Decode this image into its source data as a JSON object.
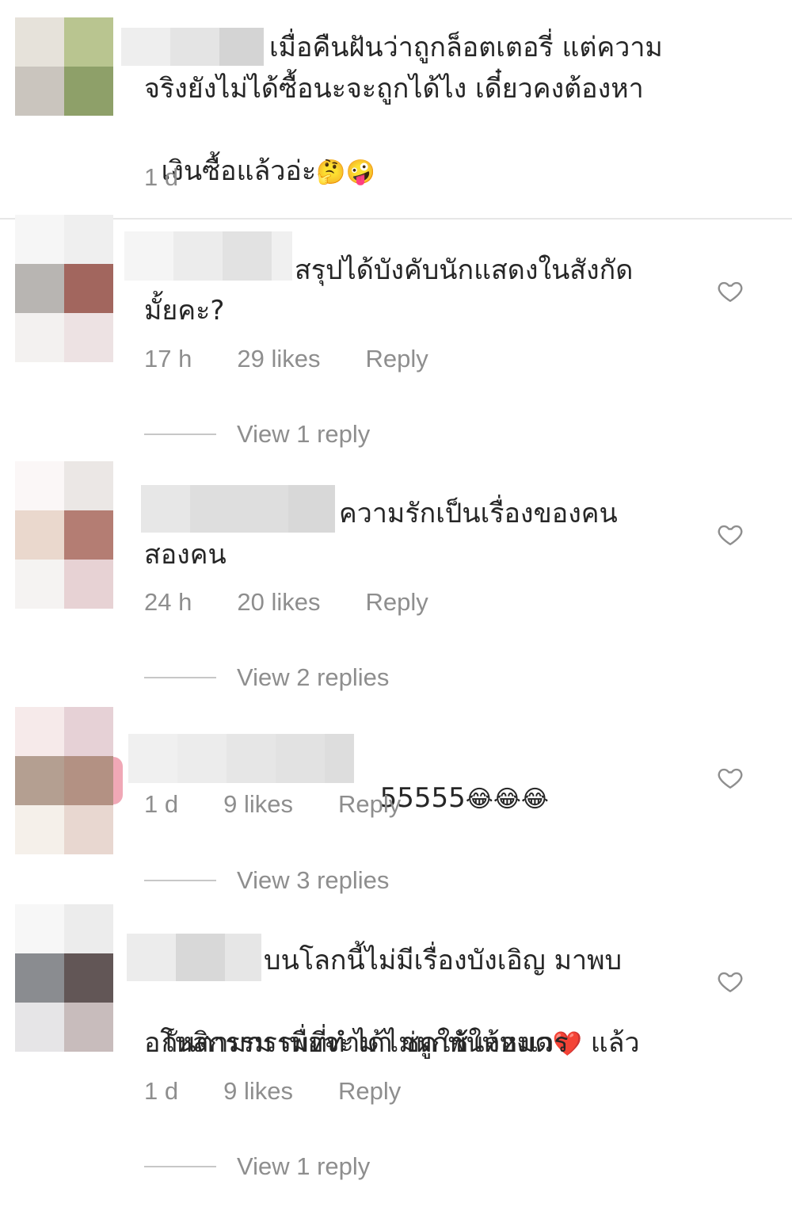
{
  "comments": [
    {
      "text_lines": [
        "เมื่อคืนฝันว่าถูกล็อตเตอรี่ แต่ความ",
        "จริงยังไม่ได้ซื้อนะจะถูกได้ไง เดี๋ยวคงต้องหา",
        "เงินซื้อแล้วอ่ะ"
      ],
      "emojis": [
        "🤔",
        "🤪"
      ],
      "time": "1 d"
    },
    {
      "text_lines": [
        "สรุปได้บังคับนักแสดงในสังกัด",
        "มั้ยคะ?"
      ],
      "time": "17 h",
      "likes": "29 likes",
      "reply": "Reply",
      "view_replies": "View 1 reply"
    },
    {
      "text_lines": [
        "ความรักเป็นเรื่องของคน",
        "สองคน"
      ],
      "time": "24 h",
      "likes": "20 likes",
      "reply": "Reply",
      "view_replies": "View 2 replies"
    },
    {
      "text_lines": [
        "55555"
      ],
      "emojis": [
        "😂",
        "😂",
        "😂"
      ],
      "time": "1 d",
      "likes": "9 likes",
      "reply": "Reply",
      "view_replies": "View 3 replies"
    },
    {
      "text_lines": [
        "บนโลกนี้ไม่มีเรื่องบังเอิญ มาพบ",
        "กันตามกรรมที่ทำมา ชดใช้ให้หมด",
        "อโหสิกรรม เพื่อจะได้ไม่ผูกพันจองเวร"
      ],
      "line2_suffix": "แล้ว",
      "heart_emoji": "❤️",
      "time": "1 d",
      "likes": "9 likes",
      "reply": "Reply",
      "view_replies": "View 1 reply"
    }
  ],
  "icons": {
    "like": "heart-outline-icon"
  },
  "colors": {
    "text": "#262626",
    "muted": "#8e8e8e",
    "heart_emoji": "#d7262f"
  }
}
